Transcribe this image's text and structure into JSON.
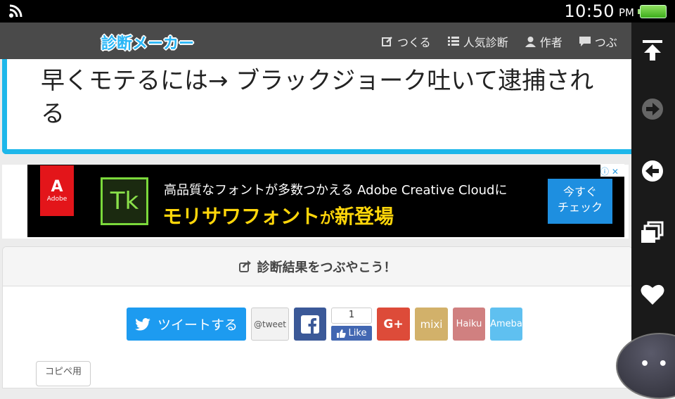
{
  "status_bar": {
    "time": "10:50",
    "ampm": "PM"
  },
  "header": {
    "logo": "診断メーカー",
    "nav": [
      {
        "label": "つくる",
        "icon": "edit-icon"
      },
      {
        "label": "人気診断",
        "icon": "list-icon"
      },
      {
        "label": "作者",
        "icon": "user-icon"
      },
      {
        "label": "つぶ",
        "icon": "comment-icon"
      }
    ]
  },
  "result": {
    "title": "早くモテるには→ ブラックジョーク吐いて逮捕される"
  },
  "ad": {
    "adobe_label": "Adobe",
    "tk_label": "Tk",
    "line1": "高品質なフォントが多数つかえる Adobe Creative Cloudに",
    "line2_main": "モリサワフォント",
    "line2_small": "が",
    "line2_end": "新登場",
    "cta": "今すぐ\nチェック",
    "ad_info": "ⓘ ✕"
  },
  "share": {
    "heading": "診断結果をつぶやこう！",
    "tweet_button": "ツイートする",
    "at_tweet": "@tweet",
    "fb_label": "f",
    "like_count": "1",
    "like_label": "Like",
    "gplus": "G+",
    "mixi": "mixi",
    "haiku": "Haiku",
    "ameba": "Ameba",
    "copy_tab": "コピペ用"
  },
  "colors": {
    "accent": "#1eb7ea",
    "header_bg": "#4a4a4a",
    "twitter": "#1d9bf0",
    "facebook": "#3b5998"
  }
}
